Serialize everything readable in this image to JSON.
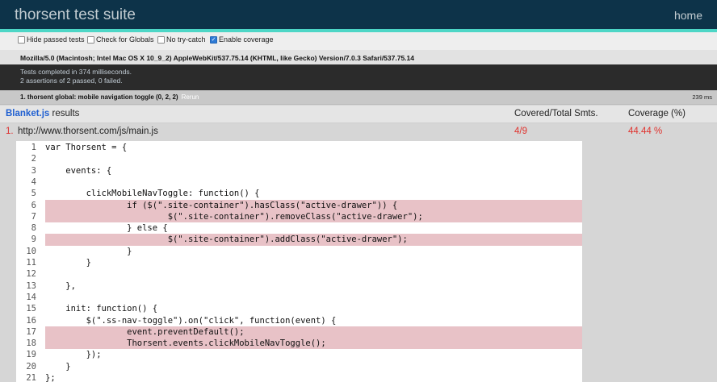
{
  "header": {
    "title": "thorsent test suite",
    "home_label": "home"
  },
  "toolbar": {
    "options": [
      {
        "label": "Hide passed tests",
        "checked": false
      },
      {
        "label": "Check for Globals",
        "checked": false
      },
      {
        "label": "No try-catch",
        "checked": false
      },
      {
        "label": "Enable coverage",
        "checked": true
      }
    ]
  },
  "useragent": "Mozilla/5.0 (Macintosh; Intel Mac OS X 10_9_2) AppleWebKit/537.75.14 (KHTML, like Gecko) Version/7.0.3 Safari/537.75.14",
  "result": {
    "line1": "Tests completed in 374 milliseconds.",
    "line2": "2 assertions of 2 passed, 0 failed."
  },
  "test": {
    "name": "1. thorsent global: mobile navigation toggle (0, 2, 2)",
    "rerun": "Rerun",
    "runtime": "239 ms"
  },
  "blanket": {
    "title_brand": "Blanket.js",
    "title_rest": " results",
    "col_covered": "Covered/Total Smts.",
    "col_coverage": "Coverage (%)"
  },
  "file": {
    "index": "1.",
    "path": "http://www.thorsent.com/js/main.js",
    "statements": "4/9",
    "coverage": "44.44 %"
  },
  "code_lines": [
    {
      "n": "1",
      "text": "var Thorsent = {",
      "miss": false
    },
    {
      "n": "2",
      "text": "",
      "miss": false
    },
    {
      "n": "3",
      "text": "    events: {",
      "miss": false
    },
    {
      "n": "4",
      "text": "",
      "miss": false
    },
    {
      "n": "5",
      "text": "        clickMobileNavToggle: function() {",
      "miss": false
    },
    {
      "n": "6",
      "text": "                if ($(\".site-container\").hasClass(\"active-drawer\")) {",
      "miss": true
    },
    {
      "n": "7",
      "text": "                        $(\".site-container\").removeClass(\"active-drawer\");",
      "miss": true
    },
    {
      "n": "8",
      "text": "                } else {",
      "miss": false
    },
    {
      "n": "9",
      "text": "                        $(\".site-container\").addClass(\"active-drawer\");",
      "miss": true
    },
    {
      "n": "10",
      "text": "                }",
      "miss": false
    },
    {
      "n": "11",
      "text": "        }",
      "miss": false
    },
    {
      "n": "12",
      "text": "",
      "miss": false
    },
    {
      "n": "13",
      "text": "    },",
      "miss": false
    },
    {
      "n": "14",
      "text": "",
      "miss": false
    },
    {
      "n": "15",
      "text": "    init: function() {",
      "miss": false
    },
    {
      "n": "16",
      "text": "        $(\".ss-nav-toggle\").on(\"click\", function(event) {",
      "miss": false
    },
    {
      "n": "17",
      "text": "                event.preventDefault();",
      "miss": true
    },
    {
      "n": "18",
      "text": "                Thorsent.events.clickMobileNavToggle();",
      "miss": true
    },
    {
      "n": "19",
      "text": "        });",
      "miss": false
    },
    {
      "n": "20",
      "text": "    }",
      "miss": false
    },
    {
      "n": "21",
      "text": "};",
      "miss": false
    }
  ]
}
